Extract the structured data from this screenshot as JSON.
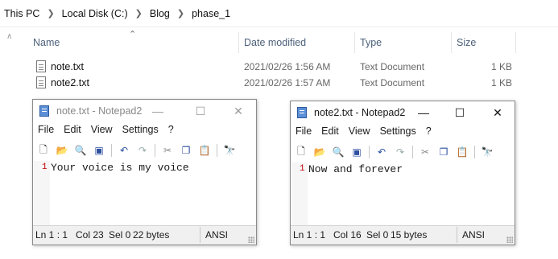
{
  "explorer": {
    "breadcrumb": [
      "This PC",
      "Local Disk (C:)",
      "Blog",
      "phase_1"
    ],
    "columns": {
      "name": "Name",
      "date": "Date modified",
      "type": "Type",
      "size": "Size"
    },
    "files": [
      {
        "name": "note.txt",
        "date": "2021/02/26 1:56 AM",
        "type": "Text Document",
        "size": "1 KB"
      },
      {
        "name": "note2.txt",
        "date": "2021/02/26 1:57 AM",
        "type": "Text Document",
        "size": "1 KB"
      }
    ]
  },
  "menu": {
    "file": "File",
    "edit": "Edit",
    "view": "View",
    "settings": "Settings",
    "help": "?"
  },
  "notepad1": {
    "title": "note.txt - Notepad2",
    "line_number": "1",
    "text": "Your voice is my voice",
    "status": {
      "pos": "Ln 1 : 1",
      "col": "Col 23",
      "sel": "Sel 0",
      "bytes": "22 bytes",
      "encoding": "ANSI"
    }
  },
  "notepad2": {
    "title": "note2.txt - Notepad2",
    "line_number": "1",
    "text": "Now and forever",
    "status": {
      "pos": "Ln 1 : 1",
      "col": "Col 16",
      "sel": "Sel 0",
      "bytes": "15 bytes",
      "encoding": "ANSI"
    }
  }
}
